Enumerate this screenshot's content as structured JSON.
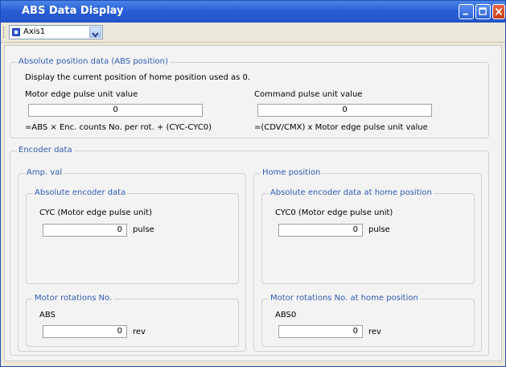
{
  "window": {
    "title": "ABS Data Display"
  },
  "toolbar": {
    "axis_selected": "Axis1"
  },
  "abs_position": {
    "legend": "Absolute position data (ABS position)",
    "description": "Display the current position of home position used as 0.",
    "motor_edge_label": "Motor edge pulse unit value",
    "motor_edge_value": "0",
    "motor_edge_formula": "=ABS × Enc. counts No. per rot. + (CYC-CYC0)",
    "command_label": "Command pulse unit value",
    "command_value": "0",
    "command_formula": "=(CDV/CMX) x Motor edge pulse unit value"
  },
  "encoder": {
    "legend": "Encoder data",
    "amp": {
      "legend": "Amp. val",
      "abs_encoder": {
        "legend": "Absolute encoder data",
        "label": "CYC (Motor edge pulse unit)",
        "value": "0",
        "unit": "pulse"
      },
      "rotations": {
        "legend": "Motor rotations No.",
        "label": "ABS",
        "value": "0",
        "unit": "rev"
      }
    },
    "home": {
      "legend": "Home position",
      "abs_encoder": {
        "legend": "Absolute encoder data at home position",
        "label": "CYC0 (Motor edge pulse unit)",
        "value": "0",
        "unit": "pulse"
      },
      "rotations": {
        "legend": "Motor rotations No. at home position",
        "label": "ABS0",
        "value": "0",
        "unit": "rev"
      }
    }
  }
}
